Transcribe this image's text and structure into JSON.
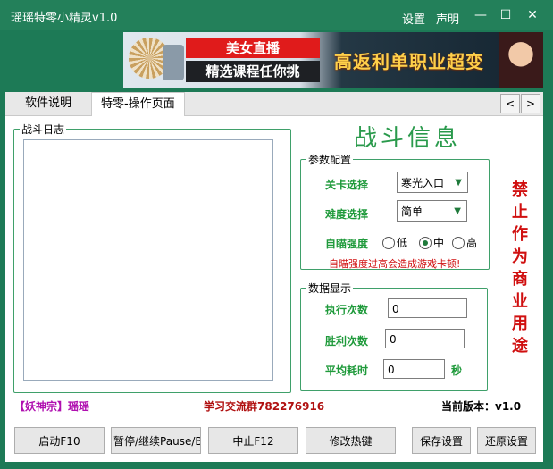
{
  "window": {
    "title": "瑶瑶特零小精灵v1.0",
    "menu": {
      "settings": "设置",
      "statement": "声明"
    },
    "controls": {
      "minimize": "—",
      "maximize": "☐",
      "close": "✕"
    }
  },
  "banner": {
    "tile1": "美女直播",
    "tile2": "精选课程任你挑",
    "slogan": "高返利单职业超变"
  },
  "tabs": [
    {
      "label": "软件说明",
      "active": false
    },
    {
      "label": "特零-操作页面",
      "active": true
    }
  ],
  "tab_nav": {
    "prev": "<",
    "next": ">"
  },
  "battle_log": {
    "legend": "战斗日志",
    "content": ""
  },
  "battle_info_title": "战斗信息",
  "params": {
    "legend": "参数配置",
    "level_label": "关卡选择",
    "level_value": "寒光入口",
    "difficulty_label": "难度选择",
    "difficulty_value": "简单",
    "aim_label": "自瞄强度",
    "aim_options": [
      "低",
      "中",
      "高"
    ],
    "aim_selected": "中",
    "warning": "自瞄强度过高会造成游戏卡顿!"
  },
  "vertical_notice": [
    "禁",
    "止",
    "作",
    "为",
    "商",
    "业",
    "用",
    "途"
  ],
  "stats": {
    "legend": "数据显示",
    "exec_label": "执行次数",
    "exec_value": "0",
    "win_label": "胜利次数",
    "win_value": "0",
    "avg_label": "平均耗时",
    "avg_value": "0",
    "avg_unit": "秒"
  },
  "footer": {
    "author": "【妖神宗】瑶瑶",
    "group": "学习交流群782276916",
    "version": "当前版本：v1.0"
  },
  "buttons": {
    "start": "启动F10",
    "pause": "暂停/继续Pause/Break",
    "stop": "中止F12",
    "hotkey": "修改热键",
    "save": "保存设置",
    "restore": "还原设置"
  },
  "colors": {
    "title_green": "#2a9a4c",
    "label_green": "#1f9a3b",
    "warning_red": "#d01010",
    "author_purple": "#b010b0",
    "group_red": "#b01010"
  }
}
